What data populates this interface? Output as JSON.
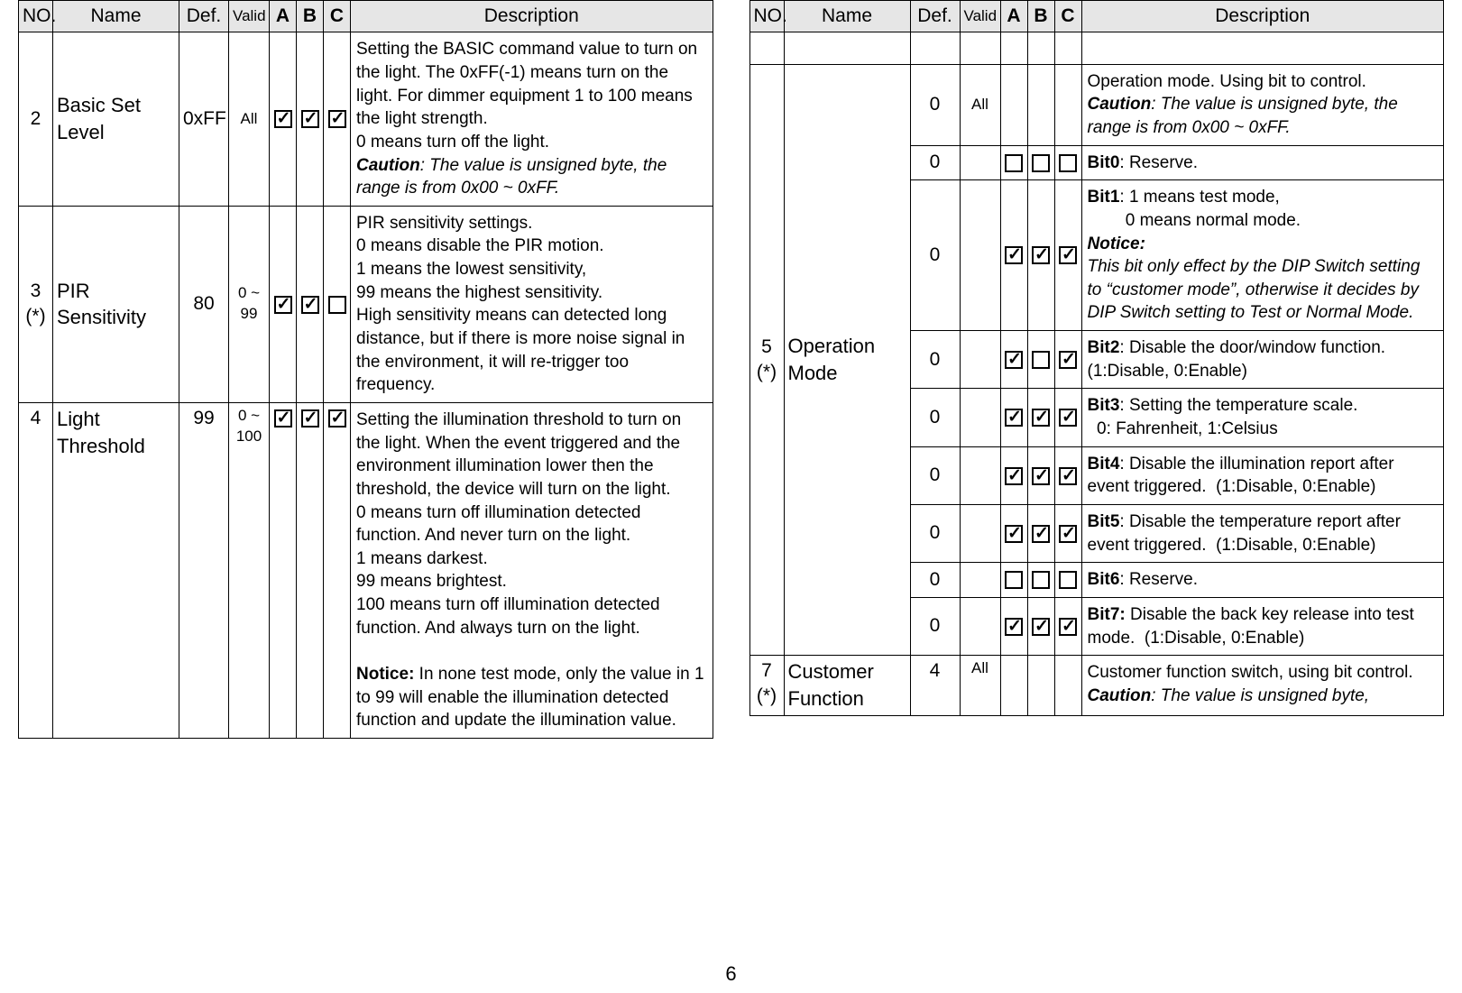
{
  "page_number": "6",
  "headers": {
    "no": "NO.",
    "name": "Name",
    "def": "Def.",
    "valid": "Valid",
    "a": "A",
    "b": "B",
    "c": "C",
    "desc": "Description"
  },
  "left_rows": [
    {
      "no": "2",
      "name": "Basic Set Level",
      "def": "0xFF",
      "valid": "All",
      "a": "checked",
      "b": "checked",
      "c": "checked",
      "desc_html": "Setting the BASIC command value to turn on the light. The 0xFF(-1) means turn on the light. For dimmer equipment 1 to 100 means the light strength.<br>0 means turn off the light.<br><b><i>Caution</i></b><i>: The value is unsigned byte, the range is from 0x00 ~ 0xFF.</i>"
    },
    {
      "no": "3<br>(*)",
      "name": "PIR Sensitivity",
      "def": "80",
      "valid": "0 ~ 99",
      "a": "checked",
      "b": "checked",
      "c": "unchecked",
      "desc_html": "PIR sensitivity settings.<br>0 means disable the PIR motion.<br>1 means the lowest sensitivity,<br>99 means the highest sensitivity.<br>High sensitivity means can detected long distance, but if there is more noise signal in the environment, it will re-trigger too frequency."
    },
    {
      "no": "4",
      "name": "Light Threshold",
      "def": "99",
      "valid": "0 ~ 100",
      "a": "checked",
      "b": "checked",
      "c": "checked",
      "vt": true,
      "desc_html": "Setting the illumination threshold to turn on the light. When the event triggered and the environment illumination lower then the threshold, the device will turn on the light.<br>0 means turn off illumination detected function. And never turn on the light.<br>1 means darkest.<br>99 means brightest.<br>100 means turn off illumination detected function. And always turn on the light.<br><br><b>Notice:</b> In none test mode, only the value in 1 to 99 will enable the illumination detected function and update the illumination value."
    }
  ],
  "right_group": {
    "no": "5<br>(*)",
    "name": "Operation Mode",
    "subrows": [
      {
        "def": "0",
        "valid": "All",
        "a": "",
        "b": "",
        "c": "",
        "desc_html": "Operation mode. Using bit to control.<br><b><i>Caution</i></b><i>: The value is unsigned byte, the range is from 0x00 ~ 0xFF.</i>"
      },
      {
        "def": "0",
        "valid": "",
        "a": "unchecked",
        "b": "unchecked",
        "c": "unchecked",
        "desc_html": "<b>Bit0</b>: Reserve."
      },
      {
        "def": "0",
        "valid": "",
        "a": "checked",
        "b": "checked",
        "c": "checked",
        "desc_html": "<b>Bit1</b>: 1 means test mode,<br>&nbsp;&nbsp;&nbsp;&nbsp;&nbsp;&nbsp;&nbsp;&nbsp;0 means normal mode.<br><b><i>Notice:</i></b><br><i>This bit only effect by the DIP Switch setting to &ldquo;customer mode&rdquo;, otherwise it decides by DIP Switch setting to Test or Normal Mode.</i>"
      },
      {
        "def": "0",
        "valid": "",
        "a": "checked",
        "b": "unchecked",
        "c": "checked",
        "desc_html": "<b>Bit2</b>: Disable the door/window function.&nbsp; (1:Disable, 0:Enable)"
      },
      {
        "def": "0",
        "valid": "",
        "a": "checked",
        "b": "checked",
        "c": "checked",
        "desc_html": "<b>Bit3</b>: Setting the temperature scale.<br>&nbsp;&nbsp;0: Fahrenheit, 1:Celsius"
      },
      {
        "def": "0",
        "valid": "",
        "a": "checked",
        "b": "checked",
        "c": "checked",
        "desc_html": "<b>Bit4</b>: Disable the illumination report after event triggered.&nbsp; (1:Disable, 0:Enable)"
      },
      {
        "def": "0",
        "valid": "",
        "a": "checked",
        "b": "checked",
        "c": "checked",
        "desc_html": "<b>Bit5</b>: Disable the temperature report after event triggered.&nbsp; (1:Disable, 0:Enable)"
      },
      {
        "def": "0",
        "valid": "",
        "a": "unchecked",
        "b": "unchecked",
        "c": "unchecked",
        "desc_html": "<b>Bit6</b>: Reserve."
      },
      {
        "def": "0",
        "valid": "",
        "a": "checked",
        "b": "checked",
        "c": "checked",
        "desc_html": "<b>Bit7:</b> Disable the back key release into test mode.&nbsp; (1:Disable, 0:Enable)"
      }
    ]
  },
  "right_last": {
    "no": "7<br>(*)",
    "name": "Customer Function",
    "def": "4",
    "valid": "All",
    "desc_html": "Customer function switch, using bit control.<br><b><i>Caution</i></b><i>: The value is unsigned byte,</i>"
  }
}
